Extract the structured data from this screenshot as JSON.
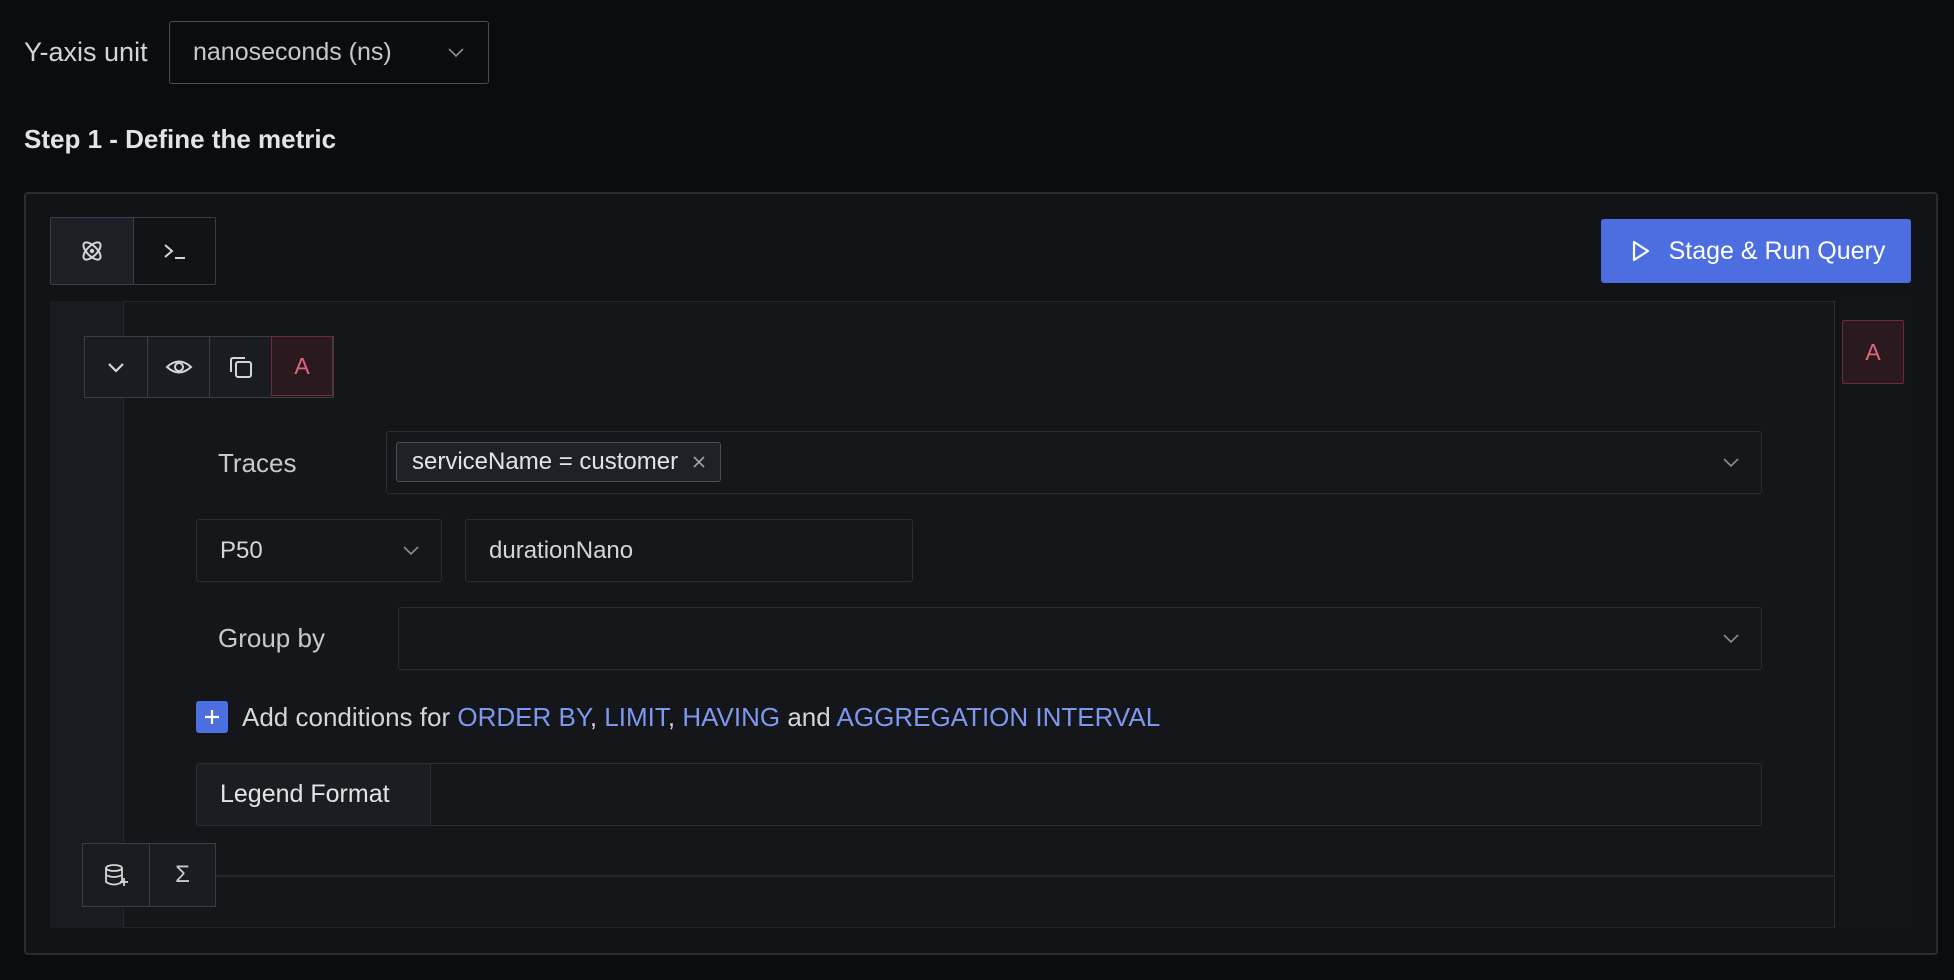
{
  "yaxis": {
    "label": "Y-axis unit",
    "selected": "nanoseconds (ns)"
  },
  "step_title": "Step 1 - Define the metric",
  "mode_toggle": {
    "icons": [
      "query-builder-icon",
      "terminal-icon"
    ]
  },
  "run_button": {
    "label": "Stage & Run Query",
    "icon": "play-icon"
  },
  "query": {
    "letter": "A",
    "right_letter": "A",
    "traces_label": "Traces",
    "filter_tag": "serviceName = customer",
    "aggregate_operator": "P50",
    "aggregate_attribute": "durationNano",
    "group_by_label": "Group by",
    "add_conditions": {
      "prefix": "Add conditions for",
      "order_by": "ORDER BY",
      "comma1": ",",
      "limit": "LIMIT",
      "comma2": ",",
      "having": "HAVING",
      "and": "and",
      "interval": "AGGREGATION INTERVAL"
    },
    "legend_label": "Legend Format",
    "legend_value": ""
  },
  "bottom_tools": {
    "sigma": "Σ"
  },
  "colors": {
    "accent": "#4c6ee0",
    "keyword": "#7d98f0",
    "query_letter": "#e0677a"
  }
}
